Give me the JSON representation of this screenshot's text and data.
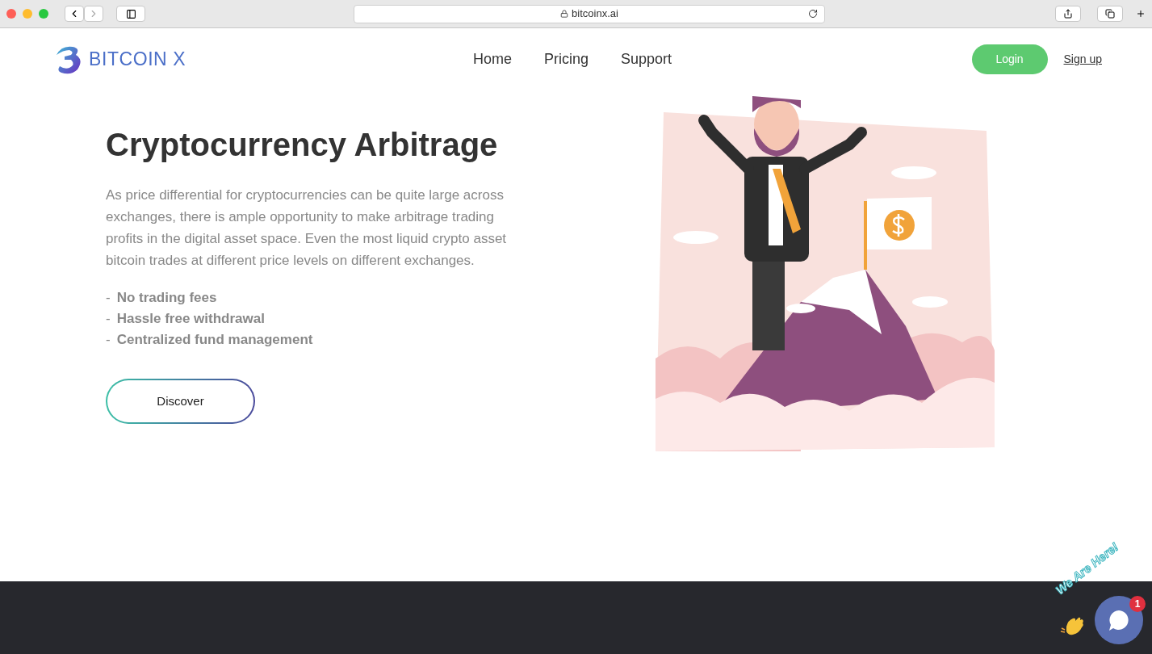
{
  "browser": {
    "url": "bitcoinx.ai"
  },
  "nav": {
    "logo_text": "BITCOIN X",
    "links": [
      "Home",
      "Pricing",
      "Support"
    ],
    "login": "Login",
    "signup": "Sign up"
  },
  "hero": {
    "title": "Cryptocurrency Arbitrage",
    "paragraph": "As price differential for cryptocurrencies can be quite large across exchanges, there is ample opportunity to make arbitrage trading profits in the digital asset space. Even the most liquid crypto asset bitcoin trades at different price levels on different exchanges.",
    "features": [
      {
        "dash": "-",
        "text": "No trading fees"
      },
      {
        "dash": "-",
        "text": "Hassle free withdrawal"
      },
      {
        "dash": "-",
        "text": "Centralized fund management"
      }
    ],
    "button": "Discover"
  },
  "chat": {
    "tagline": "We Are Here!",
    "badge": "1"
  }
}
